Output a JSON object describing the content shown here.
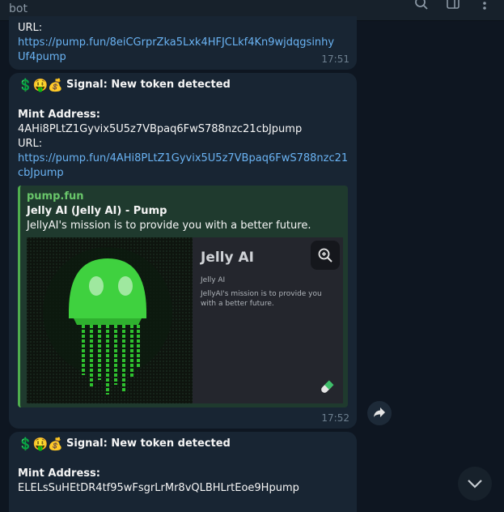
{
  "chat": {
    "title": "bot"
  },
  "messages": [
    {
      "url_label": "URL:",
      "url": "https://pump.fun/8eiCGrprZka5Lxk4HFJCLkf4Kn9wjdqgsinhyUf4pump",
      "time": "17:51"
    },
    {
      "emojis": "💲🤑💰",
      "signal_label": "Signal: New token detected",
      "mint_label": "Mint Address:",
      "mint_value": "4AHi8PLtZ1Gyvix5U5z7VBpaq6FwS788nzc21cbJpump",
      "url_label": "URL:",
      "url": "https://pump.fun/4AHi8PLtZ1Gyvix5U5z7VBpaq6FwS788nzc21cbJpump",
      "preview": {
        "site": "pump.fun",
        "title": "Jelly AI (Jelly AI) - Pump",
        "description": "JellyAI's mission is to provide you with a better future.",
        "card_title": "Jelly AI",
        "card_subtitle": "Jelly AI",
        "card_description": "JellyAI's mission is to provide you with a better future."
      },
      "time": "17:52"
    },
    {
      "emojis": "💲🤑💰",
      "signal_label": "Signal: New token detected",
      "mint_label": "Mint Address:",
      "mint_value": "ELELsSuHEtDR4tf95wFsgrLrMr8vQLBHLrtEoe9Hpump"
    }
  ],
  "icons": [
    "search-icon",
    "sidebar-toggle-icon",
    "more-vertical-icon",
    "zoom-in-icon",
    "pill-icon",
    "forward-icon",
    "chevron-down-icon"
  ],
  "colors": {
    "background": "#0e1621",
    "bubble": "#182533",
    "link": "#6ab3f3",
    "preview_accent": "#4fae4e",
    "jelly_green": "#3fd13f"
  }
}
